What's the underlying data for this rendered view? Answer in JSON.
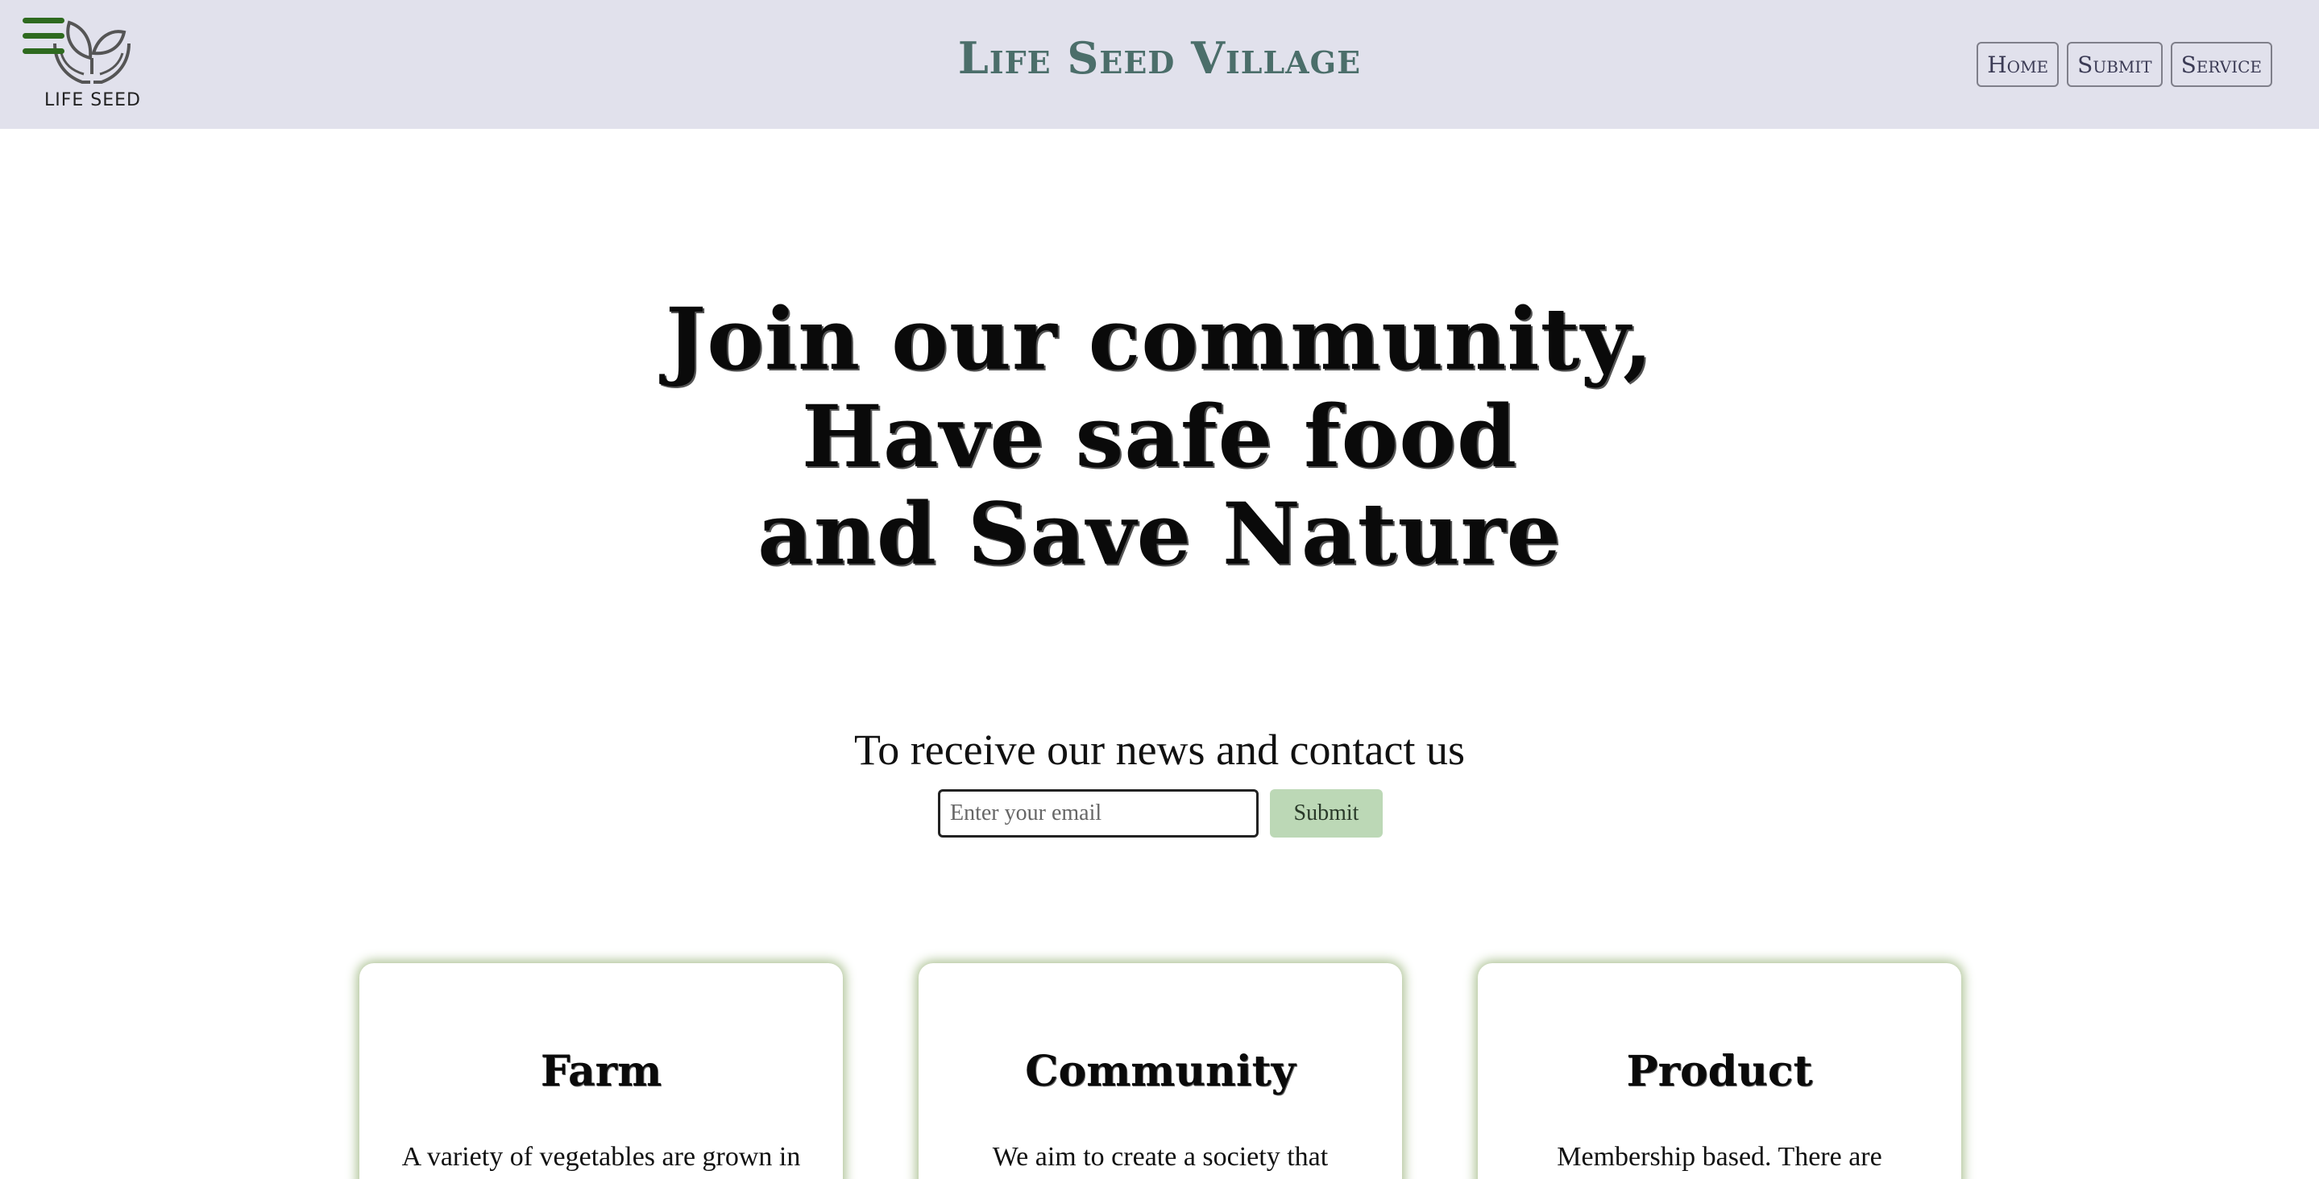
{
  "header": {
    "logo_text": "LIFE SEED",
    "title": "Life Seed Village",
    "nav": [
      {
        "label": "Home"
      },
      {
        "label": "Submit"
      },
      {
        "label": "Service"
      }
    ]
  },
  "hero": {
    "lines": [
      "Join our community,",
      "Have safe food",
      "and Save Nature"
    ]
  },
  "newsletter": {
    "heading": "To receive our news and contact us",
    "email_placeholder": "Enter your email",
    "submit_label": "Submit"
  },
  "cards": [
    {
      "title": "Farm",
      "text": "A variety of vegetables are grown in"
    },
    {
      "title": "Community",
      "text": "We aim to create a society that"
    },
    {
      "title": "Product",
      "text": "Membership based. There are"
    }
  ],
  "colors": {
    "header_bg": "#e1e1ec",
    "title": "#4b6e6a",
    "menu_icon": "#2e6a1f",
    "submit_bg": "#bcd8b6",
    "card_glow": "#a9bf8f"
  }
}
